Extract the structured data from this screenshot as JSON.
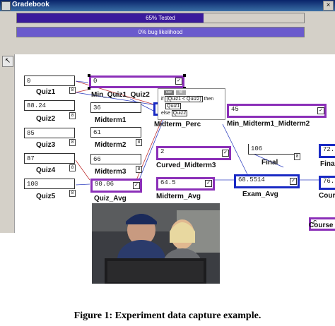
{
  "window": {
    "title": "Gradebook",
    "close_glyph": "×",
    "app_icon": "spreadsheet-icon"
  },
  "progress": {
    "tested": {
      "label": "65% Tested",
      "fraction": 0.65,
      "color": "#3a1a9c"
    },
    "bug": {
      "label": "0% bug likelihood",
      "fraction": 0.0,
      "color": "#6a5acd"
    }
  },
  "tools": {
    "arrow_glyph": "↖"
  },
  "cells": {
    "quiz1": {
      "value": "0",
      "label": "Quiz1"
    },
    "quiz2": {
      "value": "88.24",
      "label": "Quiz2"
    },
    "quiz3": {
      "value": "85",
      "label": "Quiz3"
    },
    "quiz4": {
      "value": "87",
      "label": "Quiz4"
    },
    "quiz5": {
      "value": "100",
      "label": "Quiz5"
    },
    "min_quiz": {
      "value": "0",
      "label": "Min_Quiz1_Quiz2"
    },
    "midterm1": {
      "value": "36",
      "label": "Midterm1"
    },
    "midterm2": {
      "value": "61",
      "label": "Midterm2"
    },
    "midterm3": {
      "value": "66",
      "label": "Midterm3"
    },
    "quiz_avg": {
      "value": "90.06",
      "label": "Quiz_Avg"
    },
    "midterm_perc": {
      "value": "4",
      "label": "Midterm_Perc"
    },
    "min_midterm": {
      "value": "45",
      "label": "Min_Midterm1_Midterm2"
    },
    "curved_midterm3": {
      "value": "2",
      "label": "Curved_Midterm3"
    },
    "final": {
      "value": "106",
      "label": "Final"
    },
    "final2": {
      "value": "72.",
      "label": "Fina"
    },
    "midterm_avg": {
      "value": "64.5",
      "label": "Midterm_Avg"
    },
    "exam_avg": {
      "value": "68.5514",
      "label": "Exam_Avg"
    },
    "course1": {
      "value": "76.",
      "label": "Cour"
    },
    "course2": {
      "value": "C",
      "label": "Course"
    }
  },
  "formula_popup": {
    "tag1": "use",
    "tag2": "fill",
    "line1_pre": "if",
    "line1_expr": "(Quiz1 < Quiz2)",
    "line1_post": "then",
    "line2": "Quiz1",
    "line3_pre": "else",
    "line3_ref": "Quiz2"
  },
  "marks": {
    "check": "✓",
    "lock": "8"
  },
  "caption": "Figure 1: Experiment data capture example."
}
